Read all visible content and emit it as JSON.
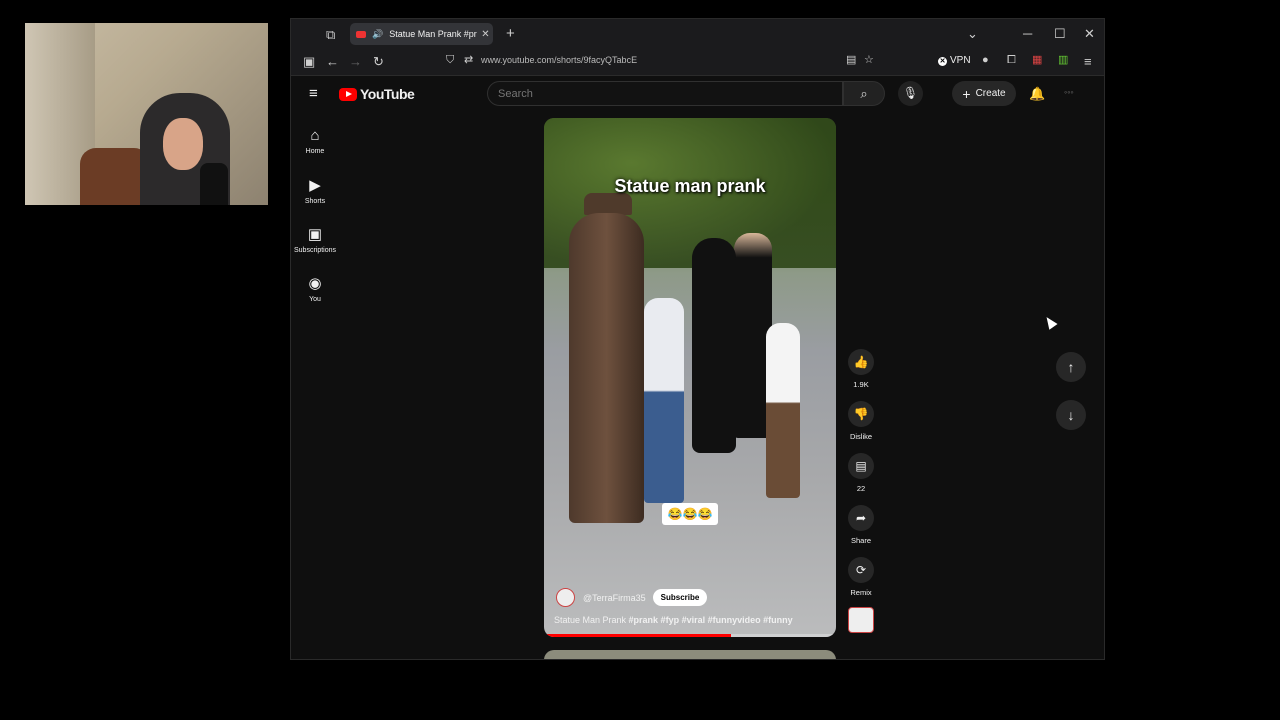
{
  "browser": {
    "tab_title": "Statue Man Prank #prank #",
    "url": "www.youtube.com/shorts/9facyQTabcE",
    "vpn_label": "VPN"
  },
  "youtube": {
    "logo_text": "YouTube",
    "search_placeholder": "Search",
    "create_label": "Create"
  },
  "sidebar": {
    "items": [
      {
        "label": "Home",
        "icon": "home-icon"
      },
      {
        "label": "Shorts",
        "icon": "shorts-icon"
      },
      {
        "label": "Subscriptions",
        "icon": "subscriptions-icon"
      },
      {
        "label": "You",
        "icon": "you-icon"
      }
    ]
  },
  "short": {
    "caption": "Statue man prank",
    "emoji": "😂😂😂",
    "channel": "@TerraFirma35",
    "subscribe_label": "Subscribe",
    "title_plain": "Statue Man Prank ",
    "title_tags": "#prank #fyp #viral #funnyvideo #funny",
    "progress": 0.64
  },
  "actions": {
    "like_count": "1.9K",
    "dislike_label": "Dislike",
    "comment_count": "22",
    "share_label": "Share",
    "remix_label": "Remix"
  }
}
